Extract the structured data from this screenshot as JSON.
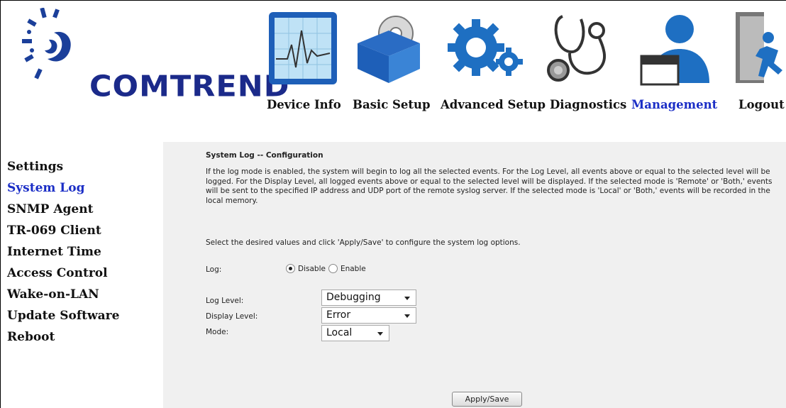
{
  "brand": {
    "name": "COMTREND"
  },
  "nav": {
    "device_info": "Device Info",
    "basic_setup": "Basic Setup",
    "advanced_setup": "Advanced Setup",
    "diagnostics": "Diagnostics",
    "management": "Management",
    "logout": "Logout",
    "active": "management"
  },
  "sidebar": {
    "items": [
      {
        "label": "Settings"
      },
      {
        "label": "System Log"
      },
      {
        "label": "SNMP Agent"
      },
      {
        "label": "TR-069 Client"
      },
      {
        "label": "Internet Time"
      },
      {
        "label": "Access Control"
      },
      {
        "label": "Wake-on-LAN"
      },
      {
        "label": "Update Software"
      },
      {
        "label": "Reboot"
      }
    ],
    "active_index": 1
  },
  "page": {
    "title": "System Log -- Configuration",
    "description": "If the log mode is enabled, the system will begin to log all the selected events. For the Log Level, all events above or equal to the selected level will be logged. For the Display Level, all logged events above or equal to the selected level will be displayed. If the selected mode is 'Remote' or 'Both,' events will be sent to the specified IP address and UDP port of the remote syslog server. If the selected mode is 'Local' or 'Both,' events will be recorded in the local memory.",
    "hint": "Select the desired values and click 'Apply/Save' to configure the system log options."
  },
  "form": {
    "log_label": "Log:",
    "log_options": {
      "disable": "Disable",
      "enable": "Enable"
    },
    "log_selected": "disable",
    "log_level_label": "Log Level:",
    "log_level_value": "Debugging",
    "display_level_label": "Display Level:",
    "display_level_value": "Error",
    "mode_label": "Mode:",
    "mode_value": "Local",
    "apply_label": "Apply/Save"
  },
  "colors": {
    "active_link": "#1b2ec6",
    "brand_blue": "#1b2a8a",
    "icon_blue": "#1e6fc2",
    "content_bg": "#f0f0f0"
  }
}
